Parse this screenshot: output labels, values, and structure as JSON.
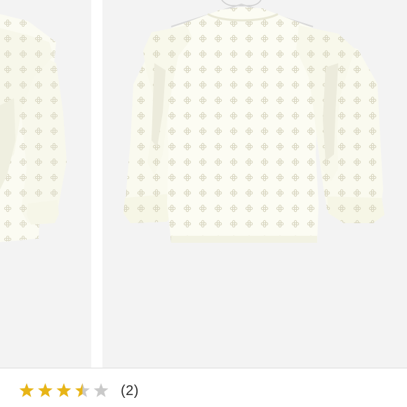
{
  "product": {
    "gallery": {
      "images": [
        {
          "alt": "",
          "state": "previous"
        },
        {
          "alt": "",
          "state": "current"
        }
      ]
    },
    "rating": {
      "value": 3.5,
      "max": 5,
      "review_count_label": "(2)",
      "filled_color": "#e7b416",
      "empty_color": "#c9c9c9"
    }
  }
}
